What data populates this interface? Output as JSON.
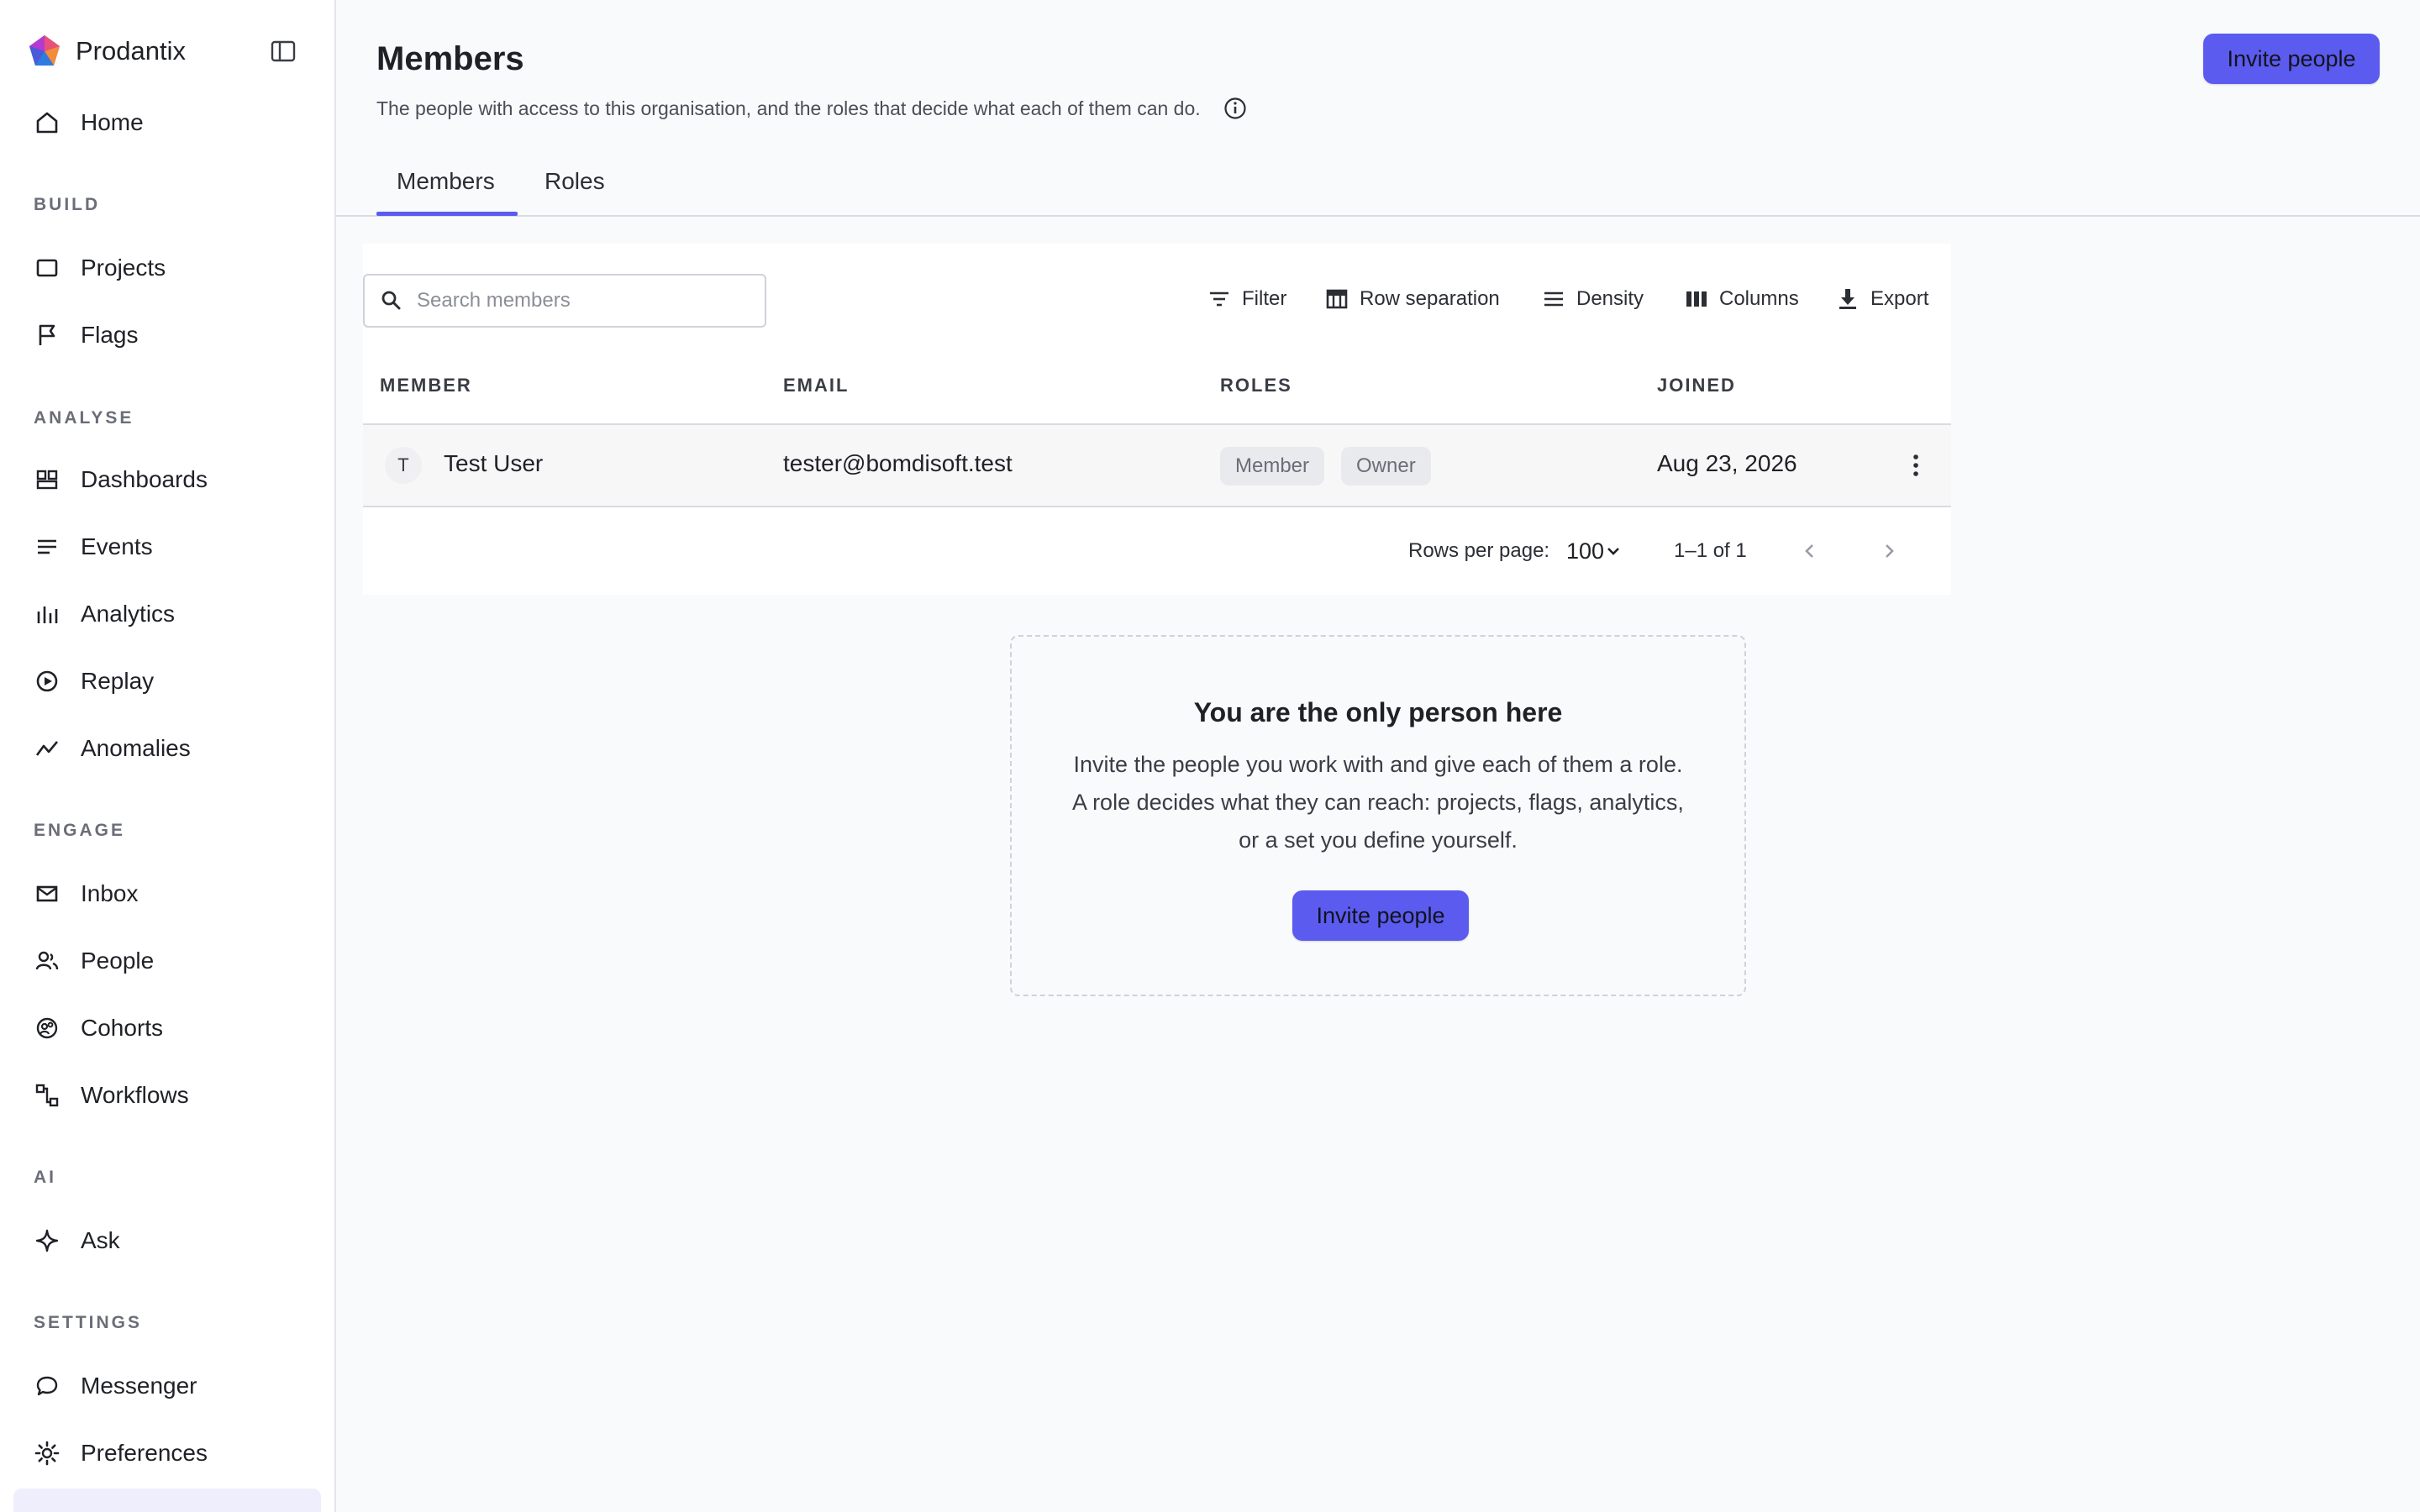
{
  "app": {
    "name": "Prodantix"
  },
  "sidebar": {
    "home": "Home",
    "sections": {
      "build": "BUILD",
      "analyse": "ANALYSE",
      "engage": "ENGAGE",
      "ai": "AI",
      "settings": "SETTINGS"
    },
    "items": {
      "projects": "Projects",
      "flags": "Flags",
      "dashboards": "Dashboards",
      "events": "Events",
      "analytics": "Analytics",
      "replay": "Replay",
      "anomalies": "Anomalies",
      "inbox": "Inbox",
      "people": "People",
      "cohorts": "Cohorts",
      "workflows": "Workflows",
      "ask": "Ask",
      "messenger": "Messenger",
      "preferences": "Preferences"
    }
  },
  "header": {
    "title": "Members",
    "subtitle": "The people with access to this organisation, and the roles that decide what each of them can do.",
    "invite_label": "Invite people"
  },
  "tabs": {
    "members": "Members",
    "roles": "Roles"
  },
  "toolbar": {
    "search_placeholder": "Search members",
    "filter": "Filter",
    "row_separation": "Row separation",
    "density": "Density",
    "columns": "Columns",
    "export": "Export"
  },
  "table": {
    "headers": {
      "member": "MEMBER",
      "email": "EMAIL",
      "roles": "ROLES",
      "joined": "JOINED"
    },
    "rows": [
      {
        "initial": "T",
        "name": "Test User",
        "email": "tester@bomdisoft.test",
        "roles": [
          "Member",
          "Owner"
        ],
        "joined": "Aug 23, 2026"
      }
    ]
  },
  "pagination": {
    "rows_per_page_label": "Rows per page:",
    "rows_per_page": "100",
    "range": "1–1 of 1"
  },
  "empty_state": {
    "title": "You are the only person here",
    "body": "Invite the people you work with and give each of them a role. A role decides what they can reach: projects, flags, analytics, or a set you define yourself.",
    "cta": "Invite people"
  },
  "colors": {
    "accent": "#5b5bf0",
    "background": "#f9fafc"
  }
}
